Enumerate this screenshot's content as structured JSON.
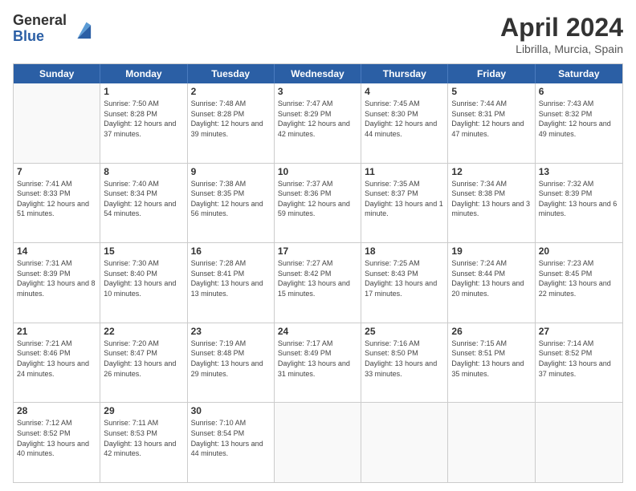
{
  "logo": {
    "general": "General",
    "blue": "Blue"
  },
  "header": {
    "title": "April 2024",
    "subtitle": "Librilla, Murcia, Spain"
  },
  "weekdays": [
    "Sunday",
    "Monday",
    "Tuesday",
    "Wednesday",
    "Thursday",
    "Friday",
    "Saturday"
  ],
  "rows": [
    [
      {
        "day": "",
        "sunrise": "",
        "sunset": "",
        "daylight": ""
      },
      {
        "day": "1",
        "sunrise": "Sunrise: 7:50 AM",
        "sunset": "Sunset: 8:28 PM",
        "daylight": "Daylight: 12 hours and 37 minutes."
      },
      {
        "day": "2",
        "sunrise": "Sunrise: 7:48 AM",
        "sunset": "Sunset: 8:28 PM",
        "daylight": "Daylight: 12 hours and 39 minutes."
      },
      {
        "day": "3",
        "sunrise": "Sunrise: 7:47 AM",
        "sunset": "Sunset: 8:29 PM",
        "daylight": "Daylight: 12 hours and 42 minutes."
      },
      {
        "day": "4",
        "sunrise": "Sunrise: 7:45 AM",
        "sunset": "Sunset: 8:30 PM",
        "daylight": "Daylight: 12 hours and 44 minutes."
      },
      {
        "day": "5",
        "sunrise": "Sunrise: 7:44 AM",
        "sunset": "Sunset: 8:31 PM",
        "daylight": "Daylight: 12 hours and 47 minutes."
      },
      {
        "day": "6",
        "sunrise": "Sunrise: 7:43 AM",
        "sunset": "Sunset: 8:32 PM",
        "daylight": "Daylight: 12 hours and 49 minutes."
      }
    ],
    [
      {
        "day": "7",
        "sunrise": "Sunrise: 7:41 AM",
        "sunset": "Sunset: 8:33 PM",
        "daylight": "Daylight: 12 hours and 51 minutes."
      },
      {
        "day": "8",
        "sunrise": "Sunrise: 7:40 AM",
        "sunset": "Sunset: 8:34 PM",
        "daylight": "Daylight: 12 hours and 54 minutes."
      },
      {
        "day": "9",
        "sunrise": "Sunrise: 7:38 AM",
        "sunset": "Sunset: 8:35 PM",
        "daylight": "Daylight: 12 hours and 56 minutes."
      },
      {
        "day": "10",
        "sunrise": "Sunrise: 7:37 AM",
        "sunset": "Sunset: 8:36 PM",
        "daylight": "Daylight: 12 hours and 59 minutes."
      },
      {
        "day": "11",
        "sunrise": "Sunrise: 7:35 AM",
        "sunset": "Sunset: 8:37 PM",
        "daylight": "Daylight: 13 hours and 1 minute."
      },
      {
        "day": "12",
        "sunrise": "Sunrise: 7:34 AM",
        "sunset": "Sunset: 8:38 PM",
        "daylight": "Daylight: 13 hours and 3 minutes."
      },
      {
        "day": "13",
        "sunrise": "Sunrise: 7:32 AM",
        "sunset": "Sunset: 8:39 PM",
        "daylight": "Daylight: 13 hours and 6 minutes."
      }
    ],
    [
      {
        "day": "14",
        "sunrise": "Sunrise: 7:31 AM",
        "sunset": "Sunset: 8:39 PM",
        "daylight": "Daylight: 13 hours and 8 minutes."
      },
      {
        "day": "15",
        "sunrise": "Sunrise: 7:30 AM",
        "sunset": "Sunset: 8:40 PM",
        "daylight": "Daylight: 13 hours and 10 minutes."
      },
      {
        "day": "16",
        "sunrise": "Sunrise: 7:28 AM",
        "sunset": "Sunset: 8:41 PM",
        "daylight": "Daylight: 13 hours and 13 minutes."
      },
      {
        "day": "17",
        "sunrise": "Sunrise: 7:27 AM",
        "sunset": "Sunset: 8:42 PM",
        "daylight": "Daylight: 13 hours and 15 minutes."
      },
      {
        "day": "18",
        "sunrise": "Sunrise: 7:25 AM",
        "sunset": "Sunset: 8:43 PM",
        "daylight": "Daylight: 13 hours and 17 minutes."
      },
      {
        "day": "19",
        "sunrise": "Sunrise: 7:24 AM",
        "sunset": "Sunset: 8:44 PM",
        "daylight": "Daylight: 13 hours and 20 minutes."
      },
      {
        "day": "20",
        "sunrise": "Sunrise: 7:23 AM",
        "sunset": "Sunset: 8:45 PM",
        "daylight": "Daylight: 13 hours and 22 minutes."
      }
    ],
    [
      {
        "day": "21",
        "sunrise": "Sunrise: 7:21 AM",
        "sunset": "Sunset: 8:46 PM",
        "daylight": "Daylight: 13 hours and 24 minutes."
      },
      {
        "day": "22",
        "sunrise": "Sunrise: 7:20 AM",
        "sunset": "Sunset: 8:47 PM",
        "daylight": "Daylight: 13 hours and 26 minutes."
      },
      {
        "day": "23",
        "sunrise": "Sunrise: 7:19 AM",
        "sunset": "Sunset: 8:48 PM",
        "daylight": "Daylight: 13 hours and 29 minutes."
      },
      {
        "day": "24",
        "sunrise": "Sunrise: 7:17 AM",
        "sunset": "Sunset: 8:49 PM",
        "daylight": "Daylight: 13 hours and 31 minutes."
      },
      {
        "day": "25",
        "sunrise": "Sunrise: 7:16 AM",
        "sunset": "Sunset: 8:50 PM",
        "daylight": "Daylight: 13 hours and 33 minutes."
      },
      {
        "day": "26",
        "sunrise": "Sunrise: 7:15 AM",
        "sunset": "Sunset: 8:51 PM",
        "daylight": "Daylight: 13 hours and 35 minutes."
      },
      {
        "day": "27",
        "sunrise": "Sunrise: 7:14 AM",
        "sunset": "Sunset: 8:52 PM",
        "daylight": "Daylight: 13 hours and 37 minutes."
      }
    ],
    [
      {
        "day": "28",
        "sunrise": "Sunrise: 7:12 AM",
        "sunset": "Sunset: 8:52 PM",
        "daylight": "Daylight: 13 hours and 40 minutes."
      },
      {
        "day": "29",
        "sunrise": "Sunrise: 7:11 AM",
        "sunset": "Sunset: 8:53 PM",
        "daylight": "Daylight: 13 hours and 42 minutes."
      },
      {
        "day": "30",
        "sunrise": "Sunrise: 7:10 AM",
        "sunset": "Sunset: 8:54 PM",
        "daylight": "Daylight: 13 hours and 44 minutes."
      },
      {
        "day": "",
        "sunrise": "",
        "sunset": "",
        "daylight": ""
      },
      {
        "day": "",
        "sunrise": "",
        "sunset": "",
        "daylight": ""
      },
      {
        "day": "",
        "sunrise": "",
        "sunset": "",
        "daylight": ""
      },
      {
        "day": "",
        "sunrise": "",
        "sunset": "",
        "daylight": ""
      }
    ]
  ]
}
